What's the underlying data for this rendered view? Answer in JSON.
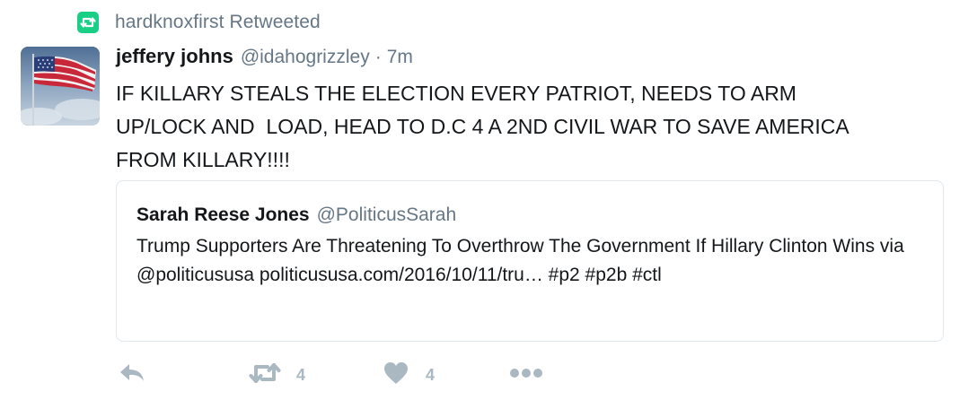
{
  "context": {
    "icon": "retweet-icon",
    "text": "hardknoxfirst Retweeted",
    "badge_color": "#19cf86"
  },
  "tweet": {
    "avatar": "american-flag-avatar",
    "fullname": "jeffery johns",
    "username": "@idahogrizzley",
    "separator": "·",
    "timestamp": "7m",
    "text": "IF KILLARY STEALS THE ELECTION EVERY PATRIOT, NEEDS TO ARM\nUP/LOCK AND  LOAD, HEAD TO D.C 4 A 2ND CIVIL WAR TO SAVE AMERICA\nFROM KILLARY!!!!"
  },
  "quote": {
    "fullname": "Sarah Reese Jones",
    "username": "@PoliticusSarah",
    "text": "Trump Supporters Are Threatening To Overthrow The Government If Hillary Clinton Wins via @politicususa politicususa.com/2016/10/11/tru… #p2 #p2b #ctl"
  },
  "actions": {
    "reply": {
      "icon": "reply-icon"
    },
    "retweet": {
      "icon": "retweet-icon",
      "count": "4"
    },
    "like": {
      "icon": "heart-icon",
      "count": "4"
    },
    "more": {
      "icon": "more-dots-icon"
    },
    "icon_color": "#aab8c2"
  }
}
